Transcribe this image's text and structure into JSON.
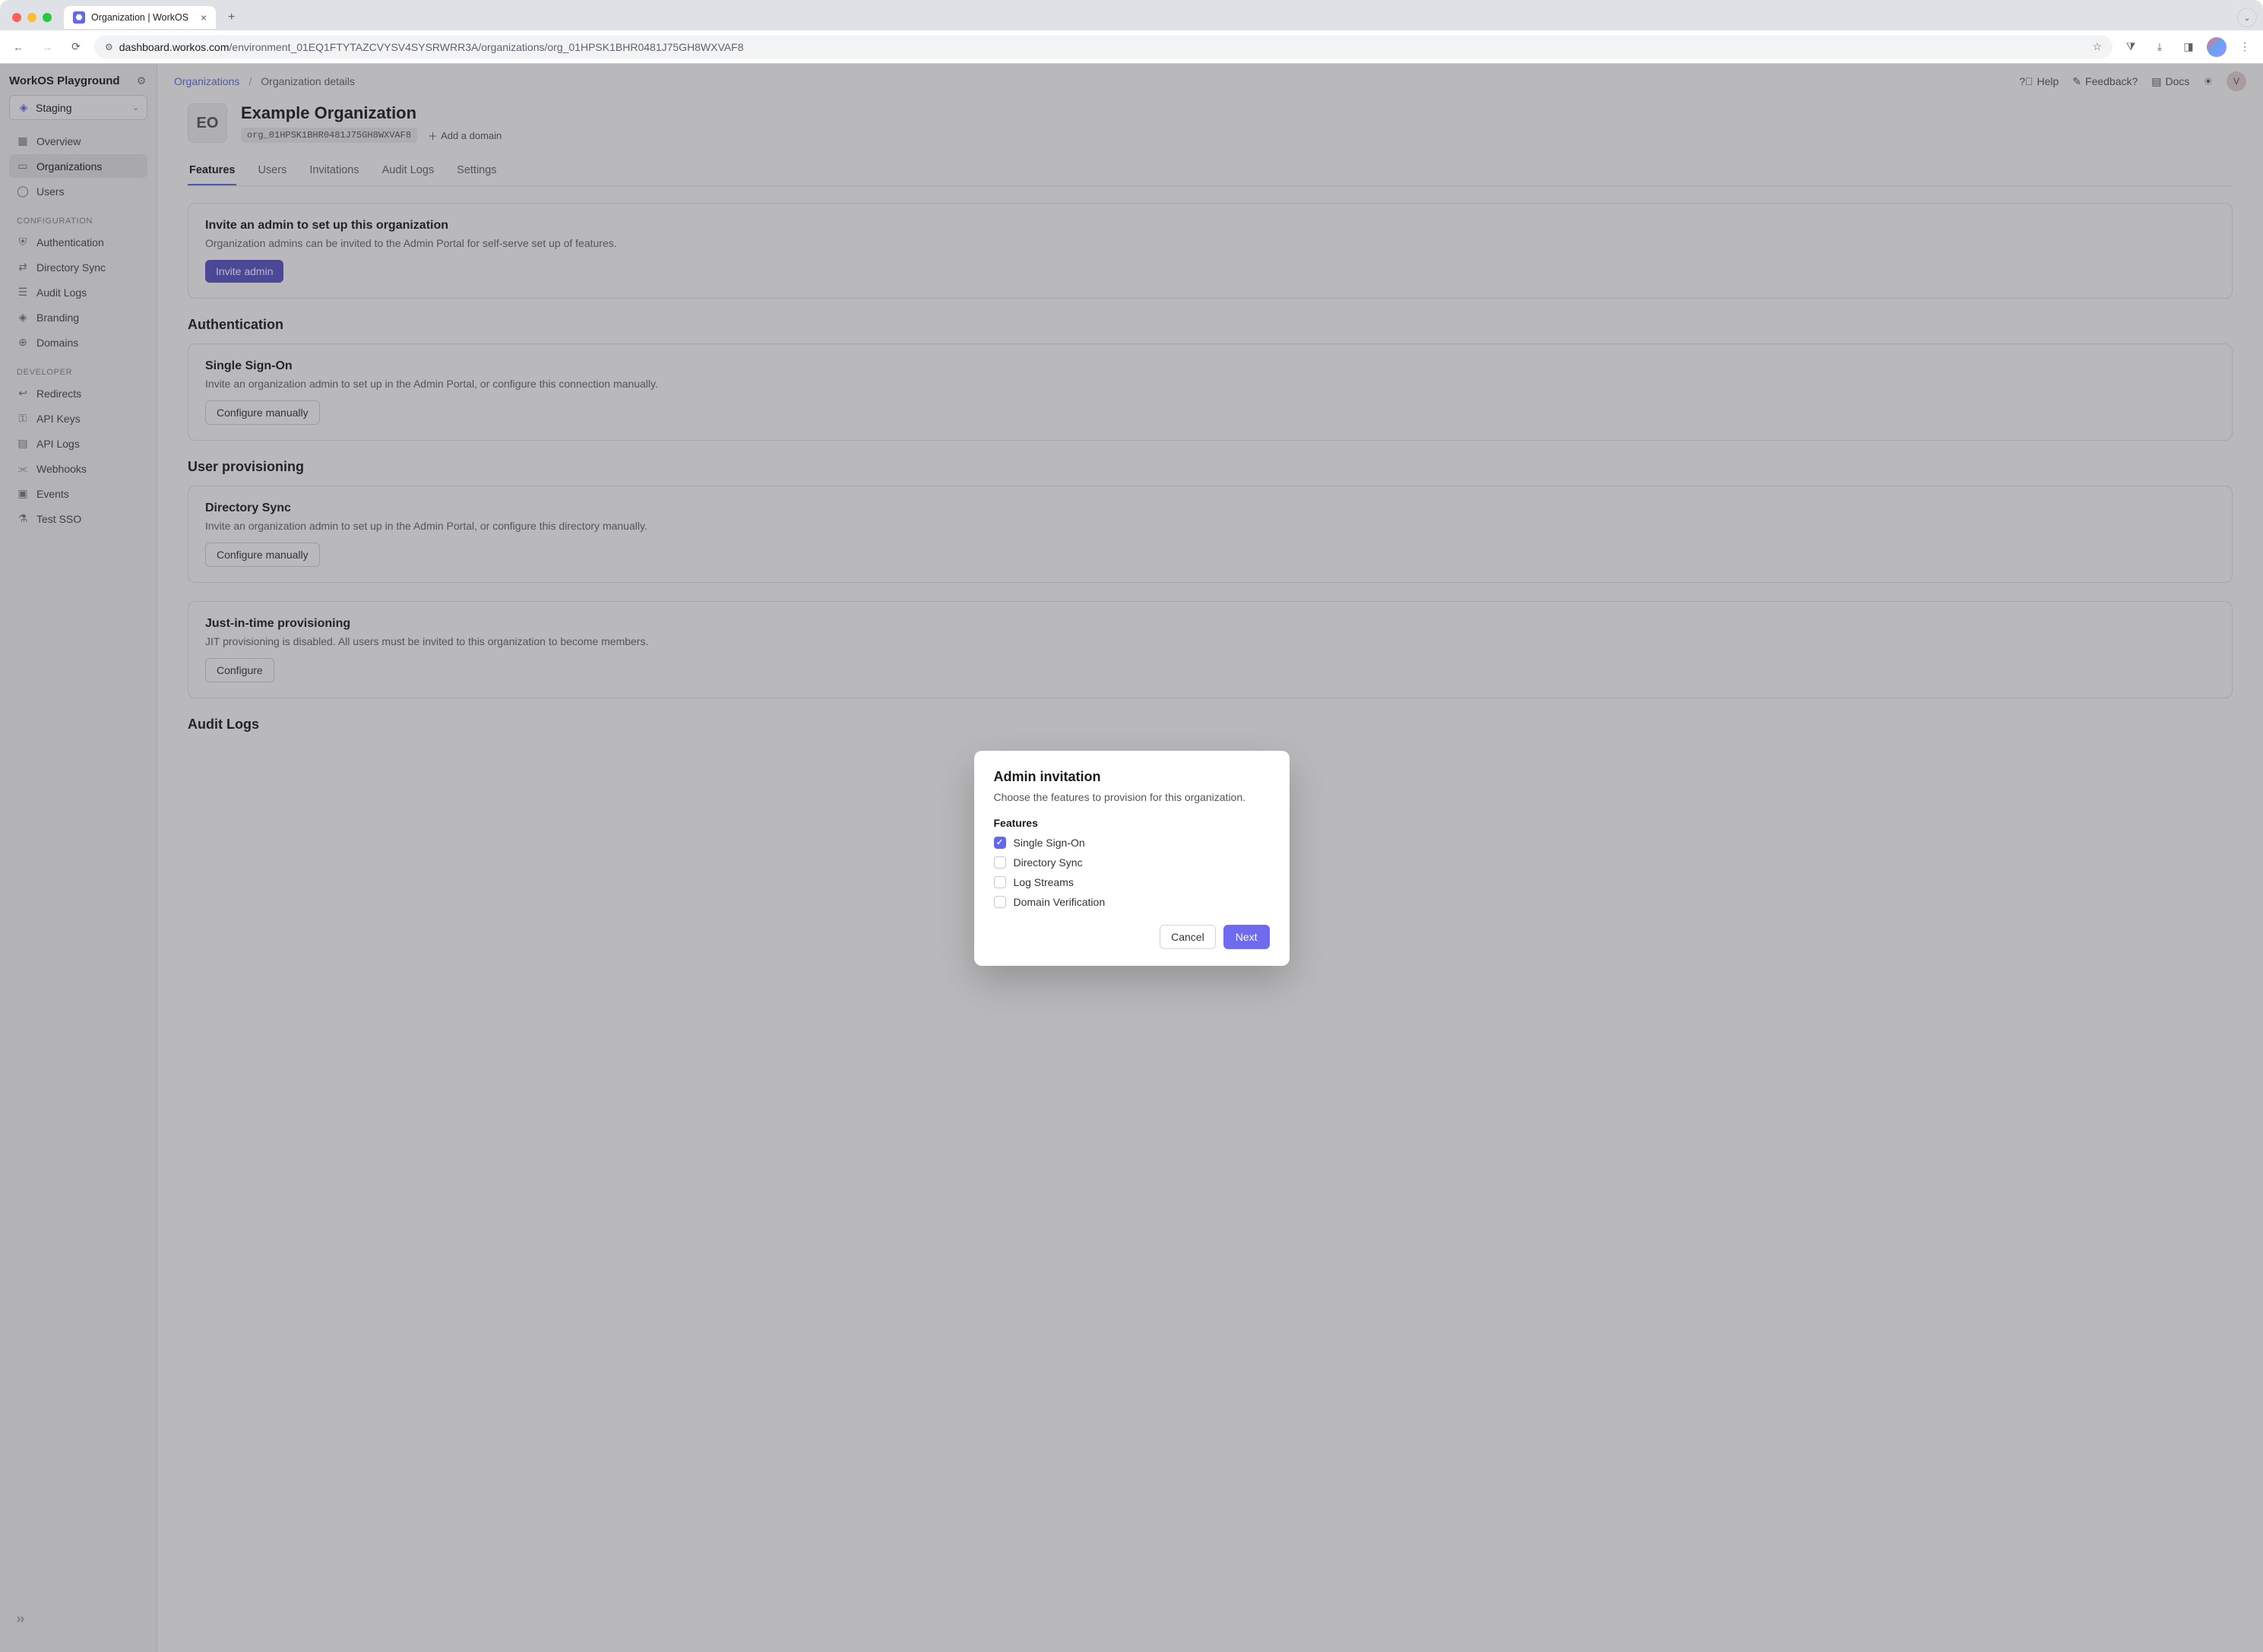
{
  "browser": {
    "tab_title": "Organization | WorkOS",
    "url_prefix": "dashboard.workos.com",
    "url_suffix": "/environment_01EQ1FTYTAZCVYSV4SYSRWRR3A/organizations/org_01HPSK1BHR0481J75GH8WXVAF8"
  },
  "sidebar": {
    "workspace": "WorkOS Playground",
    "env": "Staging",
    "items_main": [
      "Overview",
      "Organizations",
      "Users"
    ],
    "section_config": "Configuration",
    "items_config": [
      "Authentication",
      "Directory Sync",
      "Audit Logs",
      "Branding",
      "Domains"
    ],
    "section_dev": "Developer",
    "items_dev": [
      "Redirects",
      "API Keys",
      "API Logs",
      "Webhooks",
      "Events",
      "Test SSO"
    ]
  },
  "topbar": {
    "crumb_parent": "Organizations",
    "crumb_current": "Organization details",
    "actions": {
      "help": "Help",
      "feedback": "Feedback?",
      "docs": "Docs"
    },
    "avatar_initial": "V"
  },
  "org": {
    "badge": "EO",
    "name": "Example Organization",
    "id": "org_01HPSK1BHR0481J75GH8WXVAF8",
    "add_domain": "Add a domain"
  },
  "tabs": [
    "Features",
    "Users",
    "Invitations",
    "Audit Logs",
    "Settings"
  ],
  "invite_card": {
    "title": "Invite an admin to set up this organization",
    "desc": "Organization admins can be invited to the Admin Portal for self-serve set up of features.",
    "btn": "Invite admin"
  },
  "sections": {
    "auth": {
      "heading": "Authentication",
      "card_title": "Single Sign-On",
      "card_desc": "Invite an organization admin to set up in the Admin Portal, or configure this connection manually.",
      "btn": "Configure manually"
    },
    "prov": {
      "heading": "User provisioning",
      "card1": {
        "title": "Directory Sync",
        "desc": "Invite an organization admin to set up in the Admin Portal, or configure this directory manually.",
        "btn": "Configure manually"
      },
      "card2": {
        "title": "Just-in-time provisioning",
        "desc": "JIT provisioning is disabled. All users must be invited to this organization to become members.",
        "btn": "Configure"
      }
    },
    "audit": {
      "heading": "Audit Logs"
    }
  },
  "modal": {
    "title": "Admin invitation",
    "desc": "Choose the features to provision for this organization.",
    "features_label": "Features",
    "features": [
      {
        "label": "Single Sign-On",
        "checked": true
      },
      {
        "label": "Directory Sync",
        "checked": false
      },
      {
        "label": "Log Streams",
        "checked": false
      },
      {
        "label": "Domain Verification",
        "checked": false
      }
    ],
    "cancel": "Cancel",
    "next": "Next"
  }
}
